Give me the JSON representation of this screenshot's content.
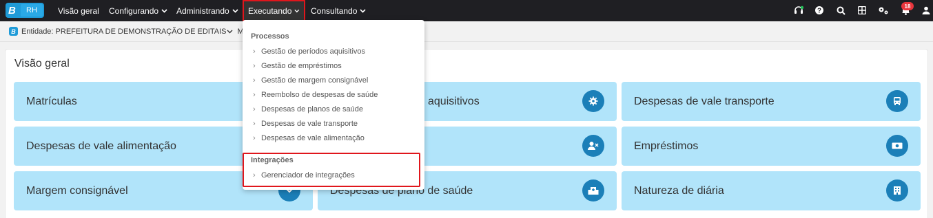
{
  "topbar": {
    "logo_letter": "B",
    "logo_app": "RH",
    "nav": {
      "visao_geral": "Visão geral",
      "configurando": "Configurando",
      "administrando": "Administrando",
      "executando": "Executando",
      "consultando": "Consultando"
    },
    "chevron": "⌄",
    "notification_count": "18",
    "icons": [
      "headset-icon",
      "help-icon",
      "search-icon",
      "apps-grid-icon",
      "settings-icon",
      "notifications-icon",
      "user-icon"
    ]
  },
  "subbar": {
    "entity_text": "Entidade: PREFEITURA DE DEMONSTRAÇÃO DE EDITAIS",
    "module_text": "MÓDU"
  },
  "main": {
    "title": "Visão geral",
    "cards": [
      {
        "label": "Matrículas",
        "icon": "badge-icon"
      },
      {
        "label": "aquisitivos",
        "icon": "gear-icon"
      },
      {
        "label": "Despesas de vale transporte",
        "icon": "bus-icon"
      },
      {
        "label": "Despesas de vale alimentação",
        "icon": "food-icon"
      },
      {
        "label": "",
        "icon": "user-x-icon"
      },
      {
        "label": "Empréstimos",
        "icon": "money-icon"
      },
      {
        "label": "Margem consignável",
        "icon": "chevron-down-icon"
      },
      {
        "label": "Despesas de plano de saúde",
        "icon": "hospital-icon"
      },
      {
        "label": "Natureza de diária",
        "icon": "building-icon"
      }
    ]
  },
  "dropdown": {
    "processos_title": "Processos",
    "processos": [
      "Gestão de períodos aquisitivos",
      "Gestão de empréstimos",
      "Gestão de margem consignável",
      "Reembolso de despesas de saúde",
      "Despesas de planos de saúde",
      "Despesas de vale transporte",
      "Despesas de vale alimentação"
    ],
    "integracoes_title": "Integrações",
    "integracoes": [
      "Gerenciador de integrações"
    ],
    "arrow": "›"
  },
  "colors": {
    "accent": "#1f9bd8",
    "card_bg": "#b1e4fa",
    "card_icon": "#1b7fb8",
    "highlight": "#e0161c",
    "topbar_bg": "#1f1f23"
  }
}
